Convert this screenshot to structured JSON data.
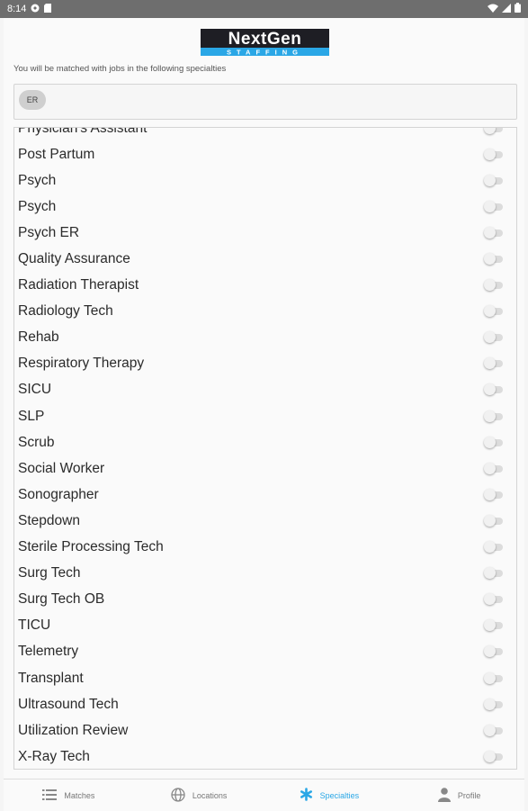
{
  "status_bar": {
    "time": "8:14"
  },
  "header": {
    "logo_text": "NextGen",
    "logo_subtext": "STAFFING",
    "subtitle": "You will be matched with jobs in the following specialties"
  },
  "selected": {
    "chips": [
      "ER"
    ]
  },
  "specialties": [
    {
      "label": "Physician's Assistant",
      "on": false
    },
    {
      "label": "Post Partum",
      "on": false
    },
    {
      "label": "Psych",
      "on": false
    },
    {
      "label": "Psych",
      "on": false
    },
    {
      "label": "Psych ER",
      "on": false
    },
    {
      "label": "Quality Assurance",
      "on": false
    },
    {
      "label": "Radiation Therapist",
      "on": false
    },
    {
      "label": "Radiology Tech",
      "on": false
    },
    {
      "label": "Rehab",
      "on": false
    },
    {
      "label": "Respiratory Therapy",
      "on": false
    },
    {
      "label": "SICU",
      "on": false
    },
    {
      "label": "SLP",
      "on": false
    },
    {
      "label": "Scrub",
      "on": false
    },
    {
      "label": "Social Worker",
      "on": false
    },
    {
      "label": "Sonographer",
      "on": false
    },
    {
      "label": "Stepdown",
      "on": false
    },
    {
      "label": "Sterile Processing Tech",
      "on": false
    },
    {
      "label": "Surg Tech",
      "on": false
    },
    {
      "label": "Surg Tech OB",
      "on": false
    },
    {
      "label": "TICU",
      "on": false
    },
    {
      "label": "Telemetry",
      "on": false
    },
    {
      "label": "Transplant",
      "on": false
    },
    {
      "label": "Ultrasound Tech",
      "on": false
    },
    {
      "label": "Utilization Review",
      "on": false
    },
    {
      "label": "X-Ray Tech",
      "on": false
    }
  ],
  "nav": {
    "matches": "Matches",
    "locations": "Locations",
    "specialties": "Specialties",
    "profile": "Profile"
  },
  "colors": {
    "accent": "#2aa7e6",
    "status_bar": "#6e6e6e",
    "logo_bg": "#1e1e24",
    "logo_stripe": "#2aa7e6"
  }
}
